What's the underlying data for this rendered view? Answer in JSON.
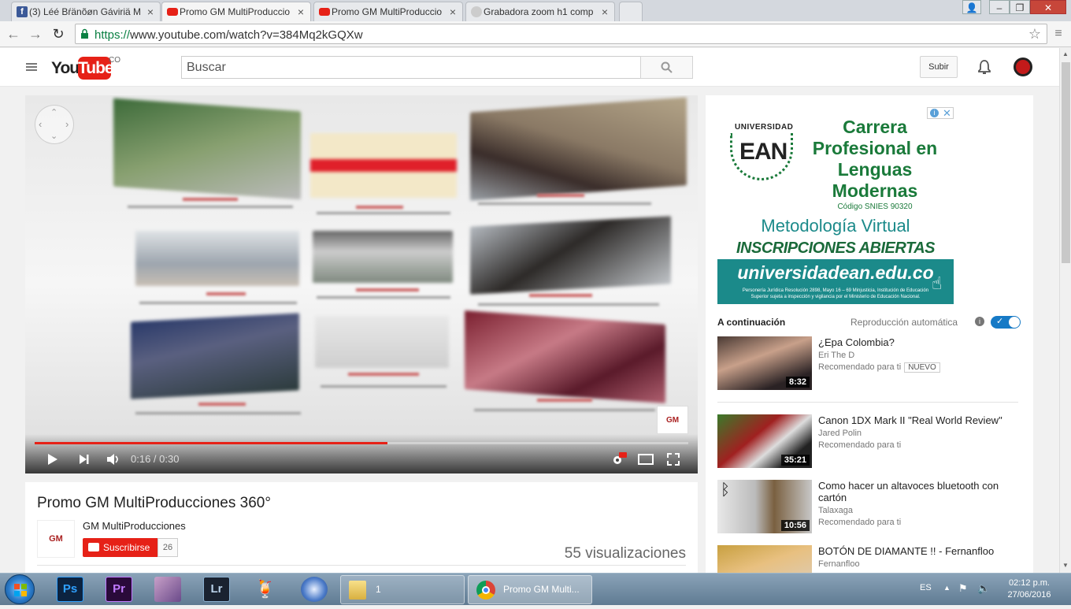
{
  "browser": {
    "tabs": [
      {
        "label": "(3) Léé Bŕänõøn Gáviriä M",
        "icon": "facebook-icon"
      },
      {
        "label": "Promo GM MultiProduccio",
        "icon": "youtube-icon",
        "active": true
      },
      {
        "label": "Promo GM MultiProduccio",
        "icon": "youtube-icon"
      },
      {
        "label": "Grabadora zoom h1 comp",
        "icon": "web-icon"
      }
    ],
    "url_scheme": "https://",
    "url_rest": "www.youtube.com/watch?v=384Mq2kGQXw"
  },
  "yt": {
    "country": "CO",
    "search_placeholder": "Buscar",
    "upload_label": "Subir"
  },
  "video": {
    "title": "Promo GM MultiProducciones 360°",
    "channel": "GM MultiProducciones",
    "subscribe_label": "Suscribirse",
    "subscriber_count": "26",
    "views": "55 visualizaciones",
    "current_time": "0:16",
    "duration": "0:30",
    "time_display": "0:16 / 0:30",
    "progress": 0.54,
    "watermark": "GM"
  },
  "ad": {
    "brand_top": "UNIVERSIDAD",
    "brand": "EAN",
    "headline": "Carrera Profesional en Lenguas Modernas",
    "line1": "Carrera",
    "line2": "Profesional en",
    "line3": "Lenguas",
    "line4": "Modernas",
    "snies": "Código SNIES 90320",
    "method": "Metodología Virtual",
    "registration": "INSCRIPCIONES ABIERTAS",
    "site": "universidadean.edu.co",
    "legal1": "Personería Jurídica Resolución 2898, Mayo 16 – 69 Minjusticia, Institución de Educación",
    "legal2": "Superior sujeta a inspección y vigilancia por el Ministerio de Educación Nacional."
  },
  "sidebar": {
    "up_next_label": "A continuación",
    "autoplay_label": "Reproducción automática",
    "autoplay_on": true,
    "items": [
      {
        "title": "¿Epa Colombia?",
        "channel": "Eri The D",
        "meta": "Recomendado para ti",
        "badge": "NUEVO",
        "duration": "8:32"
      },
      {
        "title": "Canon 1DX Mark II \"Real World Review\"",
        "channel": "Jared Polin",
        "meta": "Recomendado para ti",
        "duration": "35:21"
      },
      {
        "title": "Como hacer un altavoces bluetooth con cartón",
        "channel": "Talaxaga",
        "meta": "Recomendado para ti",
        "duration": "10:56"
      },
      {
        "title": "BOTÓN DE DIAMANTE !! - Fernanfloo",
        "channel": "Fernanfloo",
        "meta": "",
        "duration": ""
      }
    ]
  },
  "taskbar": {
    "folder_task_label": "1",
    "chrome_task_label": "Promo GM Multi...",
    "language": "ES",
    "clock_time": "02:12 p.m.",
    "clock_date": "27/06/2016"
  },
  "colors": {
    "youtube_red": "#e62117",
    "ad_green": "#1a7a3a",
    "ad_teal": "#1b8a8a",
    "autoplay_blue": "#167ac6"
  }
}
